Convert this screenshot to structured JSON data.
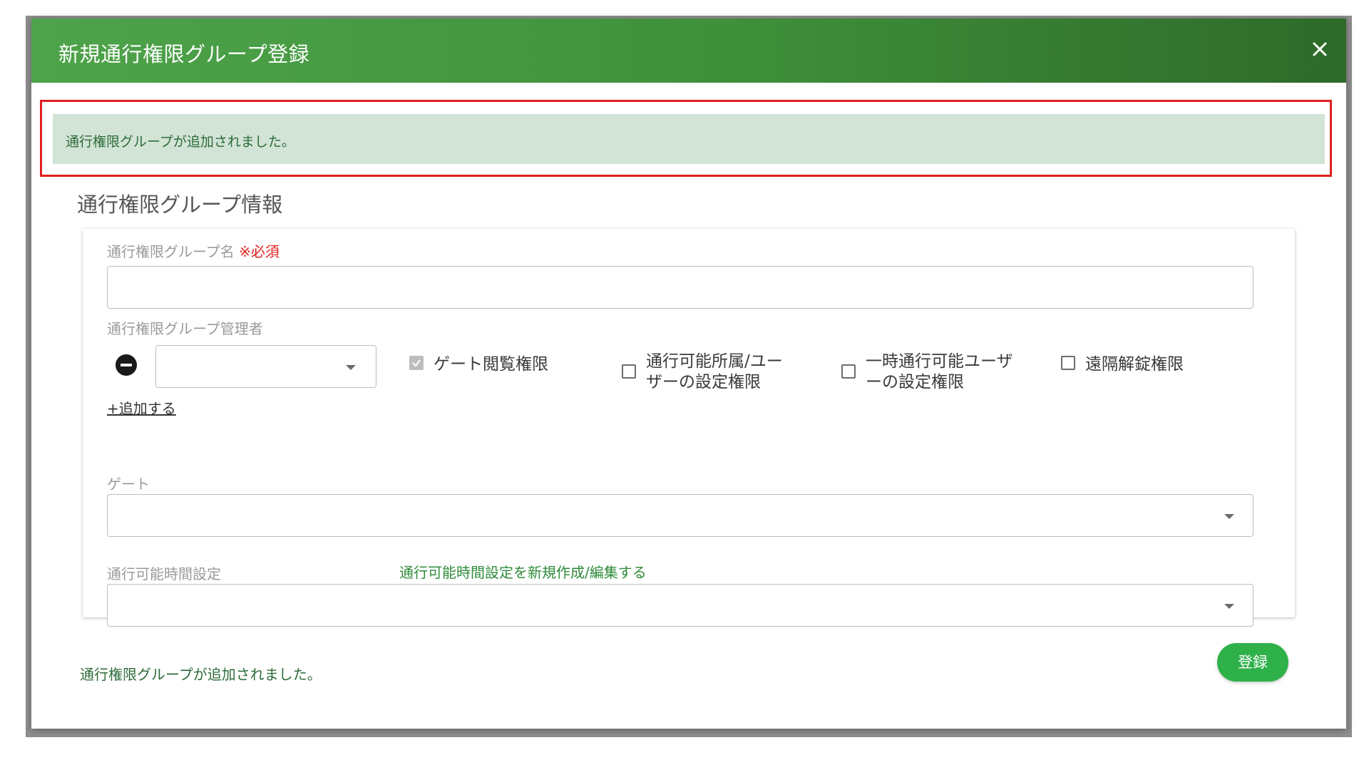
{
  "modal": {
    "title": "新規通行権限グループ登録",
    "alert_message": "通行権限グループが追加されました。",
    "section_title": "通行権限グループ情報",
    "form": {
      "group_name": {
        "label": "通行権限グループ名",
        "required_mark": "※必須",
        "value": ""
      },
      "admin": {
        "label": "通行権限グループ管理者",
        "selected": "",
        "permissions": [
          {
            "label": "ゲート閲覧権限",
            "checked": true
          },
          {
            "label_line1": "通行可能所属/ユー",
            "label_line2": "ザーの設定権限",
            "checked": false
          },
          {
            "label_line1": "一時通行可能ユーザ",
            "label_line2": "ーの設定権限",
            "checked": false
          },
          {
            "label": "遠隔解錠権限",
            "checked": false
          }
        ],
        "add_link": "+追加する"
      },
      "gate": {
        "label": "ゲート",
        "selected": ""
      },
      "time_setting": {
        "label": "通行可能時間設定",
        "edit_link": "通行可能時間設定を新規作成/編集する",
        "selected": ""
      }
    },
    "footer_message": "通行権限グループが追加されました。",
    "register_button": "登録",
    "icons": {
      "close": "close-icon",
      "remove": "minus-circle-icon",
      "caret": "caret-down-icon",
      "check": "check-icon"
    },
    "colors": {
      "header_start": "#4ea44a",
      "header_end": "#2e6a2a",
      "alert_bg": "#d2e4d6",
      "alert_text": "#2e6b3a",
      "highlight_border": "#e02020",
      "primary_button": "#2fb14a"
    }
  }
}
